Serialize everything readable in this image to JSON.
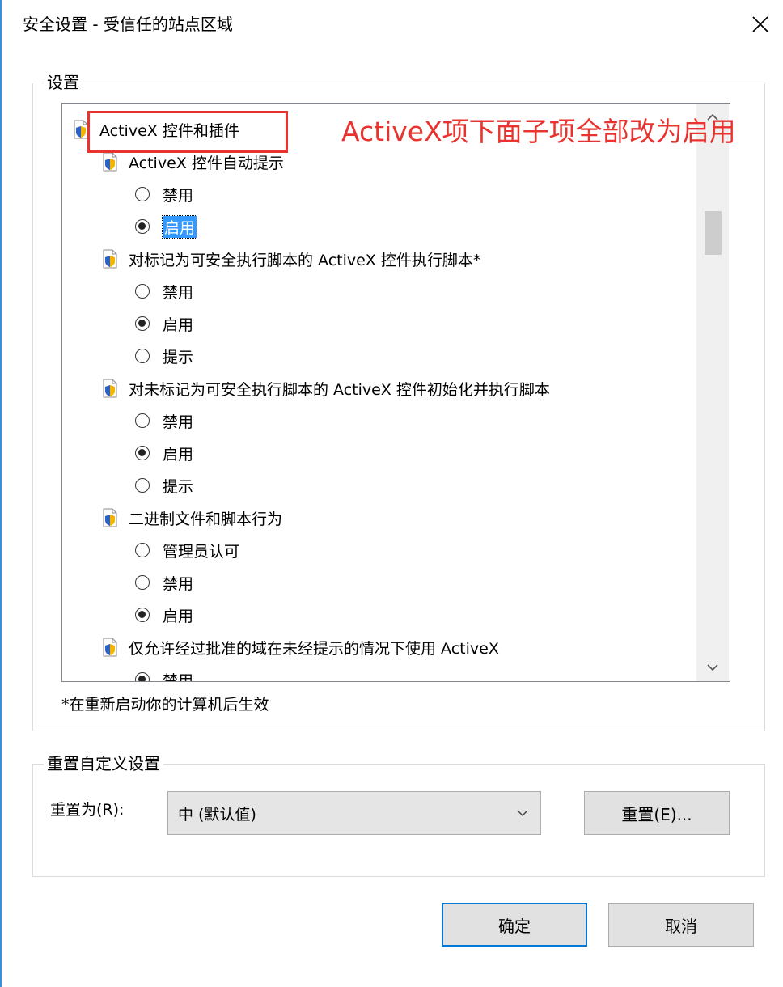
{
  "window": {
    "title": "安全设置 - 受信任的站点区域",
    "close_icon": "close-icon"
  },
  "settings_group": {
    "legend": "设置"
  },
  "tree": {
    "rows": [
      {
        "kind": "category",
        "label": "ActiveX 控件和插件",
        "icon": "settings-category-icon"
      },
      {
        "kind": "setting",
        "label": "ActiveX 控件自动提示",
        "icon": "setting-doc-icon"
      },
      {
        "kind": "option",
        "label": "禁用",
        "checked": false
      },
      {
        "kind": "option",
        "label": "启用",
        "checked": true,
        "selected": true
      },
      {
        "kind": "setting",
        "label": "对标记为可安全执行脚本的 ActiveX 控件执行脚本*",
        "icon": "setting-doc-icon"
      },
      {
        "kind": "option",
        "label": "禁用",
        "checked": false
      },
      {
        "kind": "option",
        "label": "启用",
        "checked": true
      },
      {
        "kind": "option",
        "label": "提示",
        "checked": false
      },
      {
        "kind": "setting",
        "label": "对未标记为可安全执行脚本的 ActiveX 控件初始化并执行脚本",
        "icon": "setting-doc-icon"
      },
      {
        "kind": "option",
        "label": "禁用",
        "checked": false
      },
      {
        "kind": "option",
        "label": "启用",
        "checked": true
      },
      {
        "kind": "option",
        "label": "提示",
        "checked": false
      },
      {
        "kind": "setting",
        "label": "二进制文件和脚本行为",
        "icon": "setting-doc-icon"
      },
      {
        "kind": "option",
        "label": "管理员认可",
        "checked": false
      },
      {
        "kind": "option",
        "label": "禁用",
        "checked": false
      },
      {
        "kind": "option",
        "label": "启用",
        "checked": true
      },
      {
        "kind": "setting",
        "label": "仅允许经过批准的域在未经提示的情况下使用 ActiveX",
        "icon": "setting-doc-icon"
      },
      {
        "kind": "option",
        "label": "禁用",
        "checked": true
      }
    ]
  },
  "annotation": {
    "text": "ActiveX项下面子项全部改为启用",
    "color": "#e8332f"
  },
  "footnote": "*在重新启动你的计算机后生效",
  "reset_group": {
    "legend": "重置自定义设置",
    "label": "重置为(R):",
    "select_value": "中 (默认值)",
    "reset_button": "重置(E)..."
  },
  "buttons": {
    "ok": "确定",
    "cancel": "取消"
  },
  "colors": {
    "accent": "#0078d7",
    "selection": "#3399ff"
  }
}
